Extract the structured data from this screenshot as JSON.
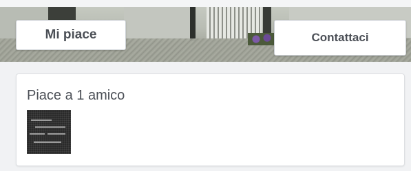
{
  "cover": {
    "buttons": {
      "like_label": "Mi piace",
      "contact_label": "Contattaci"
    }
  },
  "likes_card": {
    "text": "Piace a 1 amico"
  },
  "colors": {
    "button_text": "#4b4f56",
    "card_bg": "#ffffff",
    "page_bg": "#f1f2f4"
  }
}
